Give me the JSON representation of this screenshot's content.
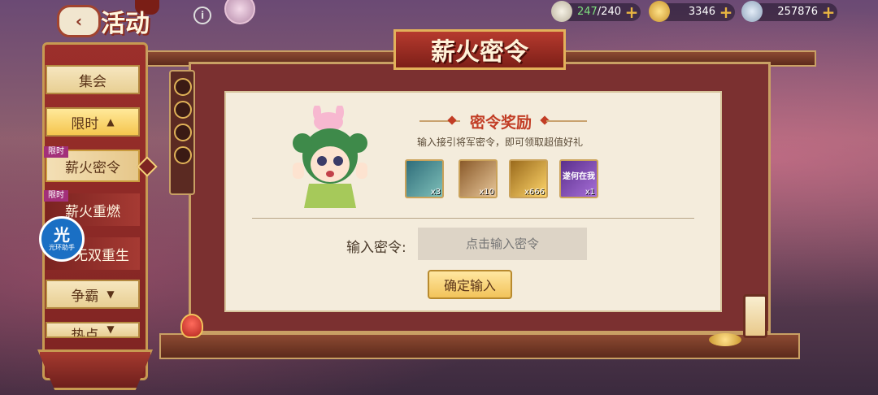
{
  "topbar": {
    "title": "活动",
    "resources": [
      {
        "name": "stamina",
        "current": "247",
        "max": "/240",
        "icon": "bun-icon"
      },
      {
        "name": "gold",
        "value": "3346",
        "icon": "gold-ingot-icon"
      },
      {
        "name": "coins",
        "value": "257876",
        "icon": "coin-icon"
      }
    ]
  },
  "sidebar": {
    "items": [
      {
        "label": "集会"
      },
      {
        "label": "限时",
        "chevron": "▲"
      },
      {
        "label": "薪火密令",
        "tag": "限时"
      },
      {
        "label": "薪火重燃",
        "tag": "限时"
      },
      {
        "label": "无双重生"
      },
      {
        "label": "争霸",
        "chevron": "▼"
      },
      {
        "label": "热点",
        "chevron": "▼"
      }
    ]
  },
  "assistant": {
    "big": "光",
    "small": "光环助手"
  },
  "panel": {
    "title": "薪火密令",
    "reward_title": "密令奖励",
    "reward_sub": "输入接引将军密令，即可领取超值好礼",
    "rewards": [
      {
        "qty": "x3",
        "icon": "jade-card-icon",
        "color": "#2f6d7a"
      },
      {
        "qty": "x10",
        "icon": "portrait-scroll-icon",
        "color": "#8a5a2a"
      },
      {
        "qty": "x666",
        "icon": "gold-ingot-icon",
        "color": "#9a6a1c"
      },
      {
        "qty": "x1",
        "icon": "purple-frame-icon",
        "color": "#5b2f8c",
        "text": "遂何在我"
      }
    ],
    "input_label": "输入密令:",
    "input_placeholder": "点击输入密令",
    "confirm_label": "确定输入"
  }
}
